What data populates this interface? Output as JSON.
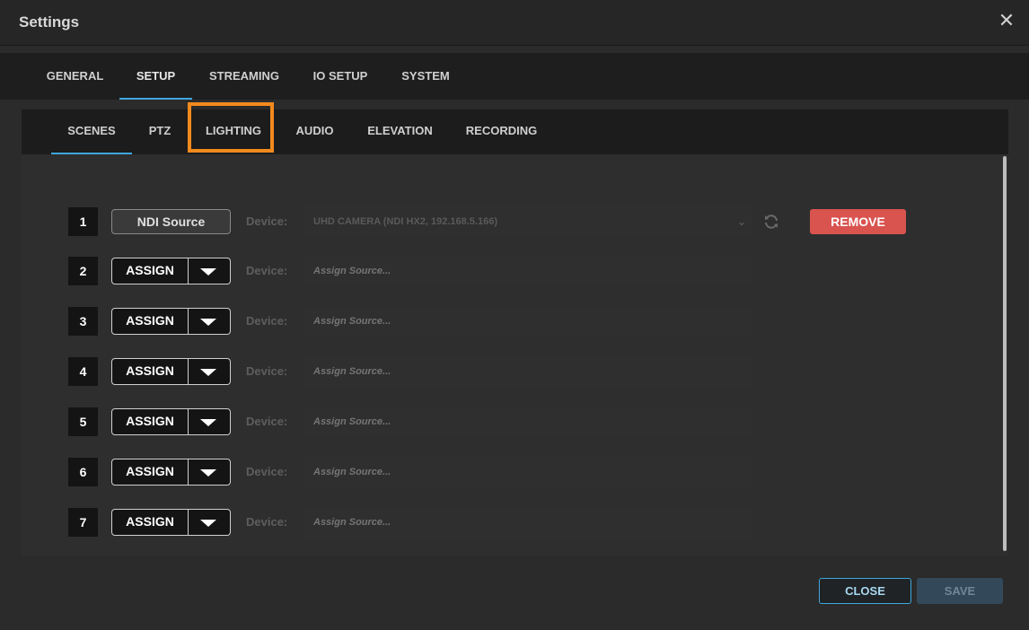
{
  "window": {
    "title": "Settings",
    "close_symbol": "✕"
  },
  "main_tabs": [
    {
      "label": "GENERAL",
      "active": false
    },
    {
      "label": "SETUP",
      "active": true
    },
    {
      "label": "STREAMING",
      "active": false
    },
    {
      "label": "IO SETUP",
      "active": false
    },
    {
      "label": "SYSTEM",
      "active": false
    }
  ],
  "sub_tabs": [
    {
      "label": "SCENES",
      "active": true
    },
    {
      "label": "PTZ",
      "active": false
    },
    {
      "label": "LIGHTING",
      "active": false,
      "highlighted": true
    },
    {
      "label": "AUDIO",
      "active": false
    },
    {
      "label": "ELEVATION",
      "active": false
    },
    {
      "label": "RECORDING",
      "active": false
    }
  ],
  "scenes": {
    "device_label": "Device:",
    "assign_label": "ASSIGN",
    "assign_placeholder": "Assign Source...",
    "rows": [
      {
        "number": "1",
        "source_type": "NDI Source",
        "device": "UHD CAMERA (NDI HX2, 192.168.5.166)",
        "remove_label": "REMOVE"
      },
      {
        "number": "2"
      },
      {
        "number": "3"
      },
      {
        "number": "4"
      },
      {
        "number": "5"
      },
      {
        "number": "6"
      },
      {
        "number": "7"
      }
    ]
  },
  "footer": {
    "close_label": "CLOSE",
    "save_label": "SAVE"
  },
  "colors": {
    "accent": "#3fa7de",
    "highlight": "#f28a1e",
    "remove": "#d9534f",
    "save_disabled": "#33495a"
  }
}
